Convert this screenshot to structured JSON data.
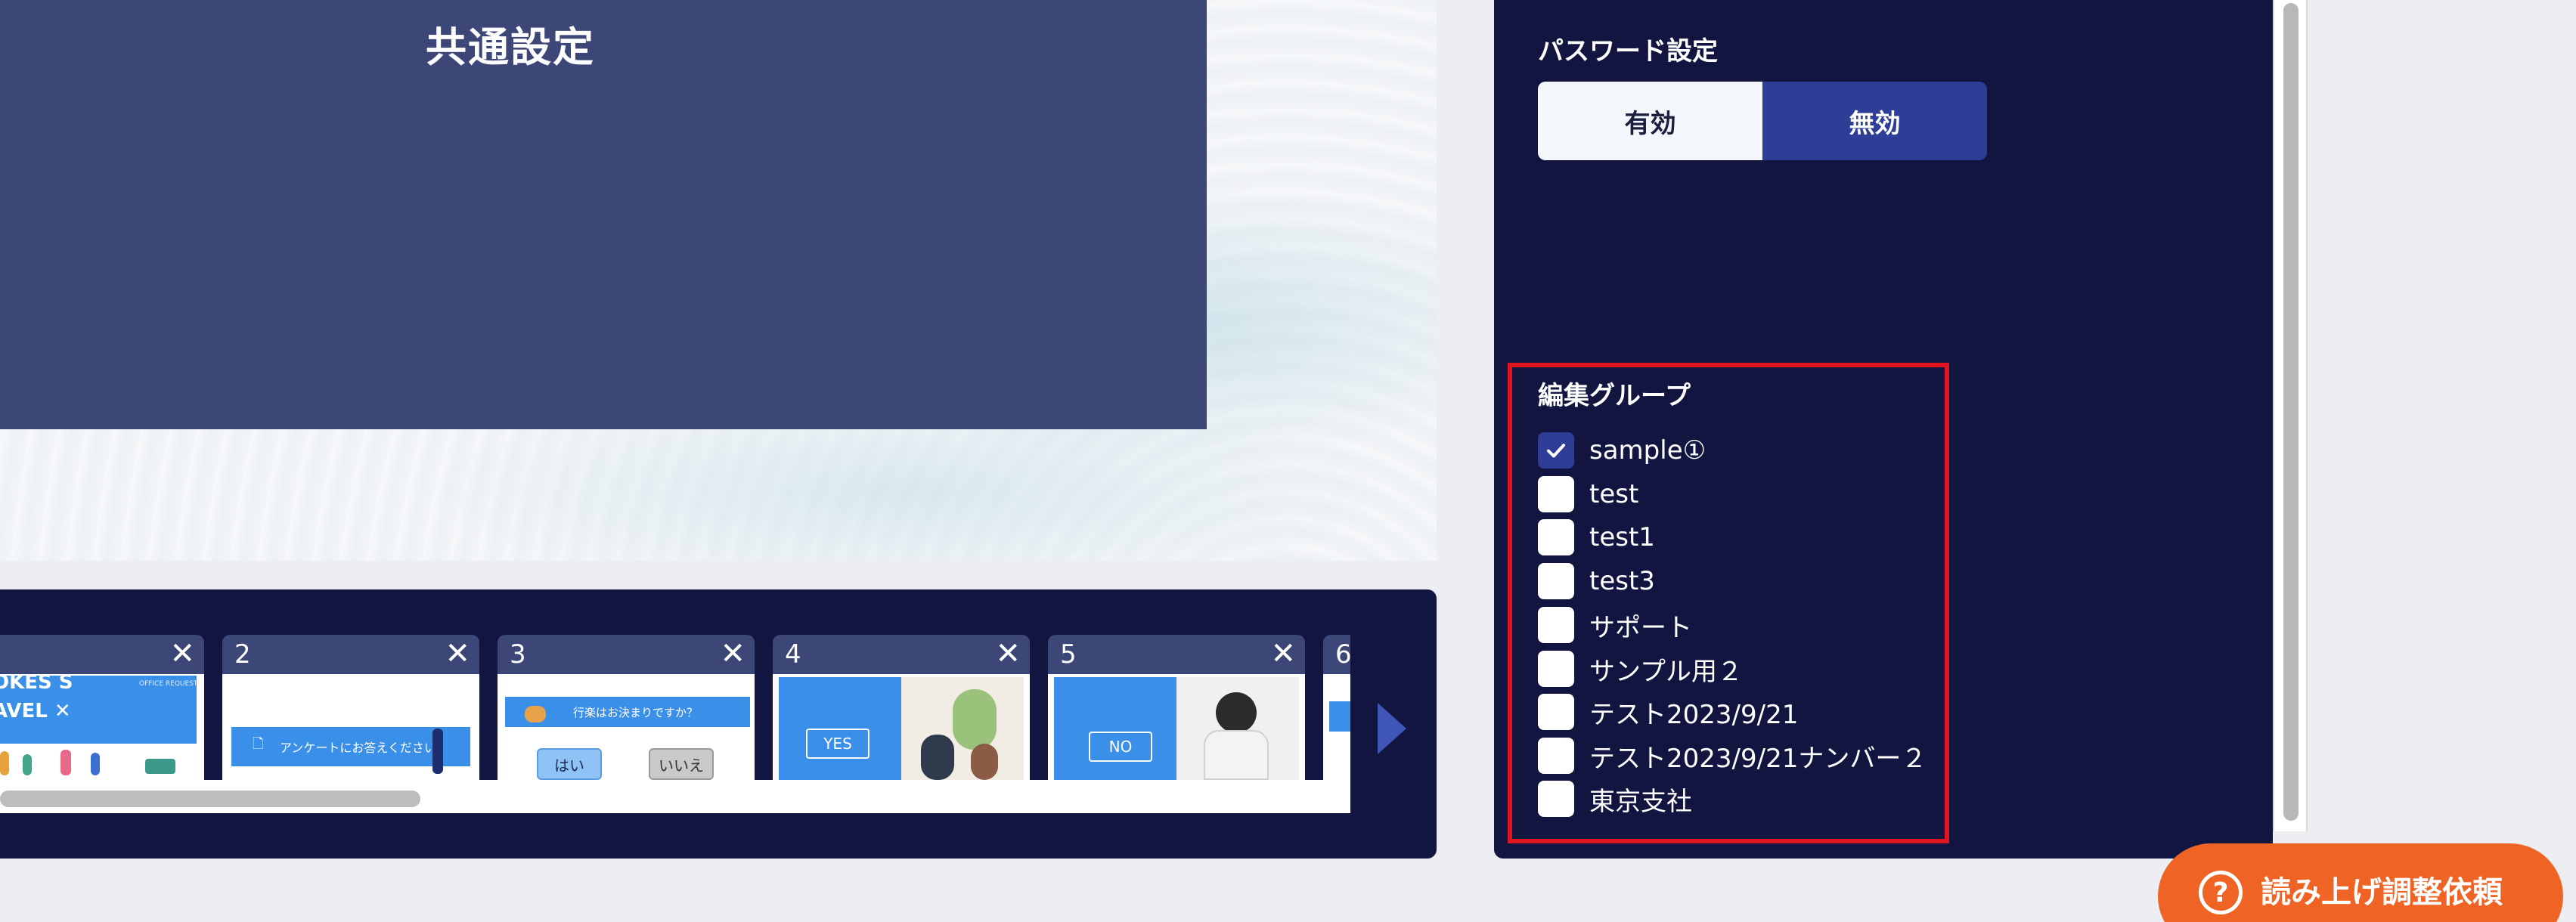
{
  "slide": {
    "title": "共通設定"
  },
  "strip": {
    "thumbnails": [
      {
        "num": "",
        "caption_top": "OKES S",
        "caption_mid": "AVEL ✕",
        "caption_tr": "OFFICE REQUEST"
      },
      {
        "num": "2",
        "text": "アンケートにお答えください"
      },
      {
        "num": "3",
        "question": "行楽はお決まりですか？",
        "yes": "はい",
        "no": "いいえ"
      },
      {
        "num": "4",
        "button": "YES"
      },
      {
        "num": "5",
        "button": "NO"
      },
      {
        "num": "6"
      }
    ],
    "close_glyph": "✕"
  },
  "panel": {
    "password": {
      "label": "パスワード設定",
      "option_on": "有効",
      "option_off": "無効",
      "selected": "無効"
    },
    "group": {
      "label": "編集グループ",
      "items": [
        {
          "label": "sample①",
          "checked": true
        },
        {
          "label": "test",
          "checked": false
        },
        {
          "label": "test1",
          "checked": false
        },
        {
          "label": "test3",
          "checked": false
        },
        {
          "label": "サポート",
          "checked": false
        },
        {
          "label": "サンプル用２",
          "checked": false
        },
        {
          "label": "テスト2023/9/21",
          "checked": false
        },
        {
          "label": "テスト2023/9/21ナンバー２",
          "checked": false
        },
        {
          "label": "東京支社",
          "checked": false
        }
      ]
    }
  },
  "help": {
    "icon": "?",
    "label": "読み上げ調整依頼"
  },
  "colors": {
    "navy": "#111540",
    "slide": "#3c4677",
    "accent": "#2e3e96",
    "orange": "#ef6424",
    "highlight_red": "#e0141e"
  }
}
